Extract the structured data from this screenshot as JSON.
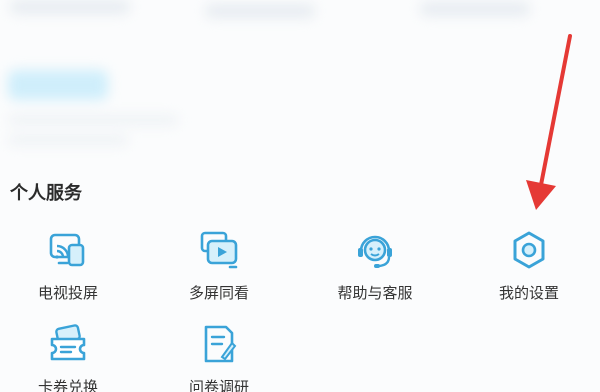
{
  "section": {
    "title": "个人服务"
  },
  "services": [
    {
      "label": "电视投屏",
      "icon": "tv-cast-icon"
    },
    {
      "label": "多屏同看",
      "icon": "multi-screen-icon"
    },
    {
      "label": "帮助与客服",
      "icon": "customer-service-icon"
    },
    {
      "label": "我的设置",
      "icon": "settings-icon"
    },
    {
      "label": "卡券兑换",
      "icon": "coupon-icon"
    },
    {
      "label": "问卷调研",
      "icon": "survey-icon"
    }
  ],
  "colors": {
    "icon": "#3aa3d8",
    "icon_fill": "#d6f0fb",
    "arrow": "#e53935",
    "text": "#333333"
  }
}
